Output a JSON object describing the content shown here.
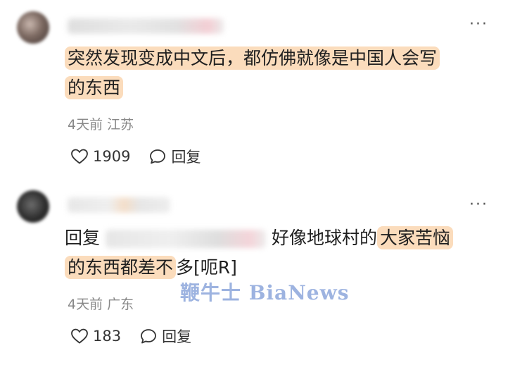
{
  "comments": [
    {
      "text_lines": [
        "突然发现变成中文后，都仿佛就像是中国人会写",
        "的东西"
      ],
      "meta": "4天前 江苏",
      "likes": "1909",
      "reply_label": "回复",
      "more_label": "···"
    },
    {
      "reply_prefix": "回复",
      "text_part_plain": "好像地球村的",
      "text_part_highlight_1": "大家苦恼",
      "text_part_highlight_2": "的东西都差不",
      "text_part_tail": "多[呃R]",
      "meta": "4天前 广东",
      "likes": "183",
      "reply_label": "回复",
      "more_label": "···"
    }
  ],
  "watermark": "鞭牛士 BiaNews",
  "colors": {
    "highlight": "#fbdcbc",
    "watermark": "#9db3e0",
    "meta": "#888888"
  },
  "icons": {
    "like": "heart-icon",
    "reply": "chat-bubble-icon",
    "more": "more-dots-icon"
  }
}
